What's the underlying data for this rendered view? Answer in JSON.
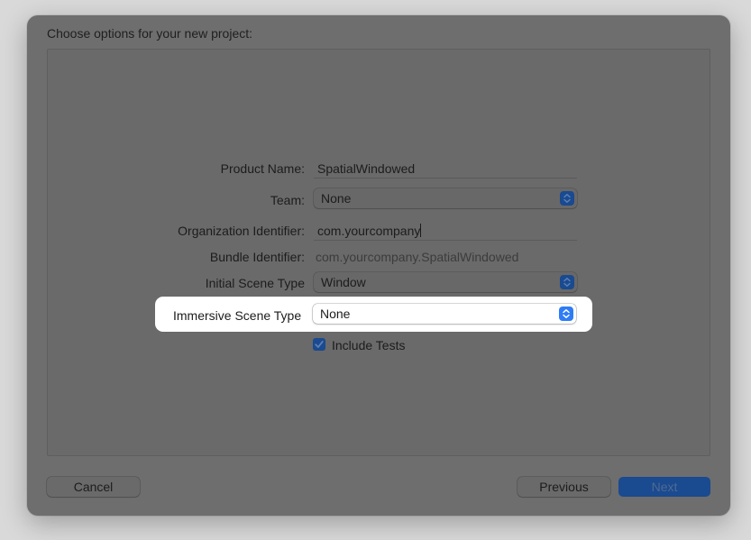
{
  "dialog": {
    "title": "Choose options for your new project:"
  },
  "form": {
    "product_name": {
      "label": "Product Name:",
      "value": "SpatialWindowed"
    },
    "team": {
      "label": "Team:",
      "value": "None"
    },
    "organization_identifier": {
      "label": "Organization Identifier:",
      "value": "com.yourcompany"
    },
    "bundle_identifier": {
      "label": "Bundle Identifier:",
      "value": "com.yourcompany.SpatialWindowed"
    },
    "initial_scene_type": {
      "label": "Initial Scene Type",
      "value": "Window"
    },
    "immersive_scene_type": {
      "label": "Immersive Scene Type",
      "value": "None"
    },
    "include_tests": {
      "label": "Include Tests",
      "checked": true
    }
  },
  "buttons": {
    "cancel": "Cancel",
    "previous": "Previous",
    "next": "Next"
  },
  "icons": {
    "popup_stepper": "chevron-up-down-icon",
    "checkbox": "checkmark-icon"
  },
  "colors": {
    "accent": "#2f7cf6",
    "dimmed_accent": "#1a4a8f",
    "highlight": "#ffffff"
  }
}
